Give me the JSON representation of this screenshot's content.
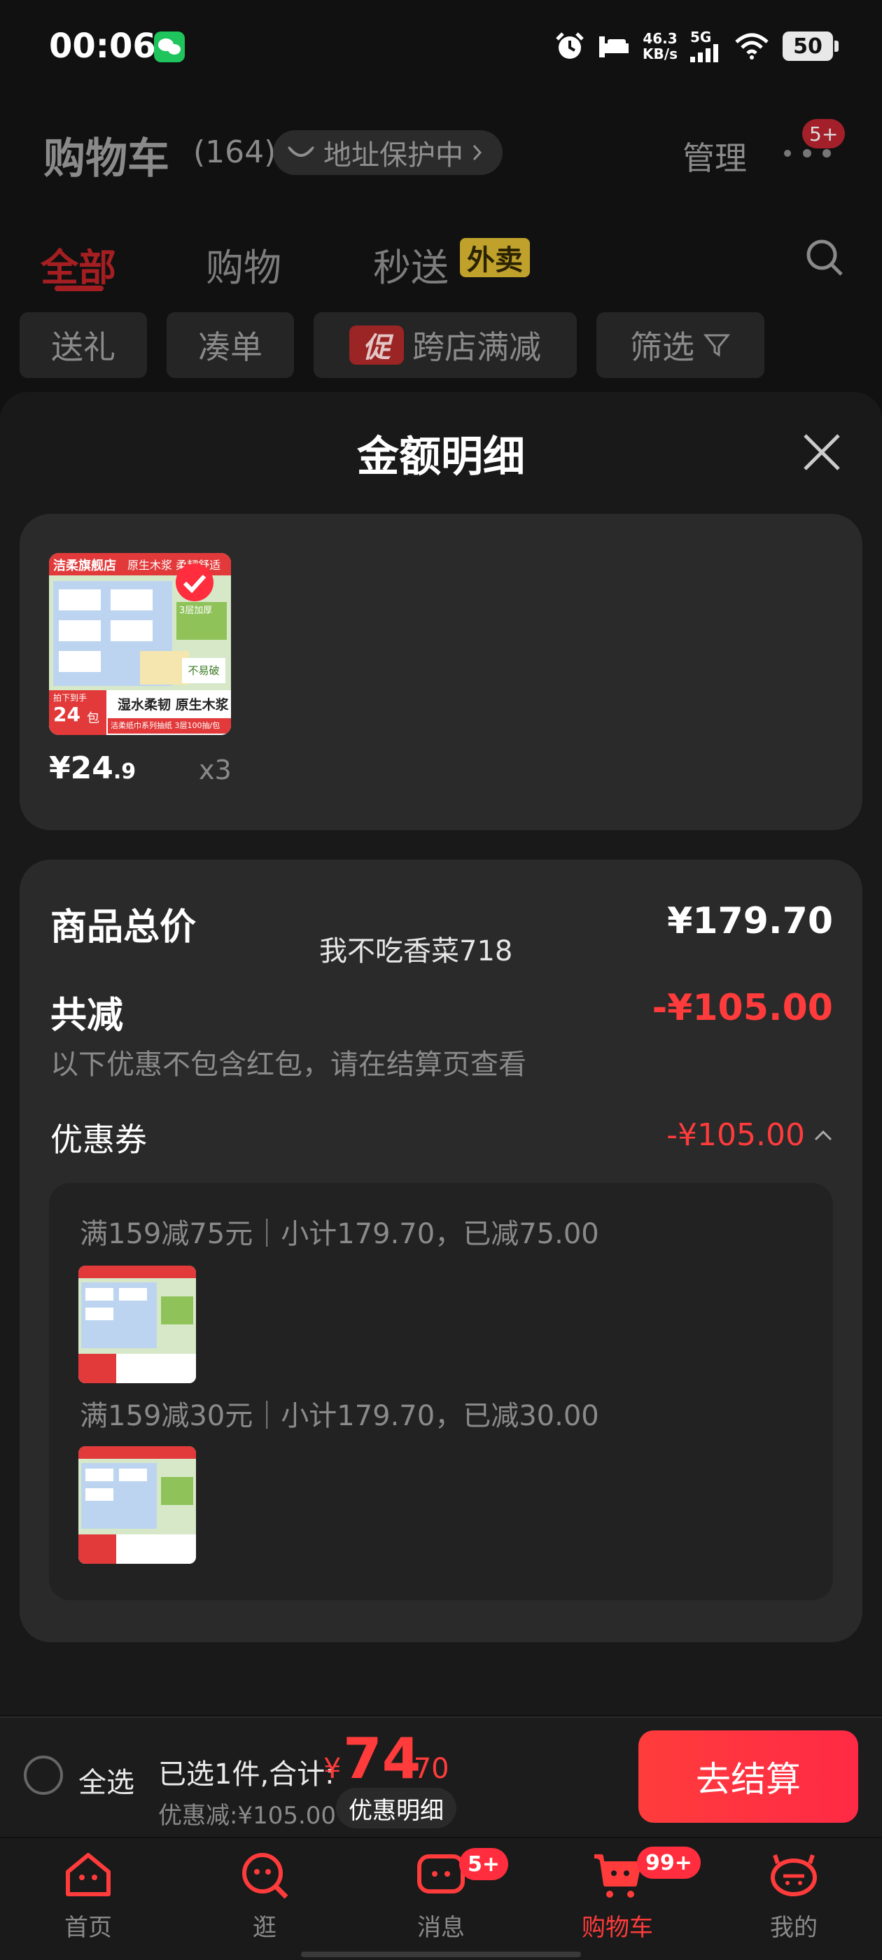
{
  "status_bar": {
    "time": "00:06",
    "net_speed_value": "46.3",
    "net_speed_unit": "KB/s",
    "network": "5G",
    "battery": "50"
  },
  "header": {
    "title": "购物车",
    "count": "(164)",
    "address_protect": "地址保护中",
    "manage": "管理",
    "more_badge": "5+"
  },
  "tabs": [
    {
      "label": "全部"
    },
    {
      "label": "购物"
    },
    {
      "label": "秒送",
      "tag": "外卖"
    }
  ],
  "chips": [
    {
      "label": "送礼"
    },
    {
      "label": "凑单"
    },
    {
      "label": "跨店满减",
      "tag": "促"
    },
    {
      "label": "筛选"
    }
  ],
  "sheet": {
    "title": "金额明细",
    "product": {
      "price_main": "¥24",
      "price_decimal": ".9",
      "qty": "x3",
      "img_text": {
        "store": "洁柔旗舰店",
        "top_tag": "原生木浆 柔韧舒适",
        "side": "3层加厚",
        "feature": "不易破",
        "bottom": "湿水柔韧 原生木浆",
        "count_label": "拍下到手",
        "count": "24",
        "count_unit": "包",
        "sub": "洁柔纸巾系列抽纸 3层100抽/包"
      }
    },
    "summary": {
      "total_label": "商品总价",
      "total_value": "¥179.70",
      "watermark": "我不吃香菜718",
      "reduce_label": "共减",
      "reduce_value": "-¥105.00",
      "note": "以下优惠不包含红包，请在结算页查看",
      "coupon_label": "优惠券",
      "coupon_value": "-¥105.00",
      "coupons": [
        {
          "text": "满159减75元｜小计179.70，已减75.00"
        },
        {
          "text": "满159减30元｜小计179.70，已减30.00"
        }
      ]
    }
  },
  "checkout": {
    "select_all": "全选",
    "selected": "已选1件,合计:",
    "yen": "¥",
    "total_int": "74",
    "total_dec": ".70",
    "discount": "优惠减:¥105.00",
    "detail": "优惠明细",
    "button": "去结算"
  },
  "tabbar": [
    {
      "label": "首页"
    },
    {
      "label": "逛"
    },
    {
      "label": "消息",
      "badge": "5+"
    },
    {
      "label": "购物车",
      "badge": "99+"
    },
    {
      "label": "我的"
    }
  ],
  "colors": {
    "accent_red": "#ff3b3b",
    "inactive_red": "#a51e22",
    "waimai_yellow": "#bfa12c"
  }
}
